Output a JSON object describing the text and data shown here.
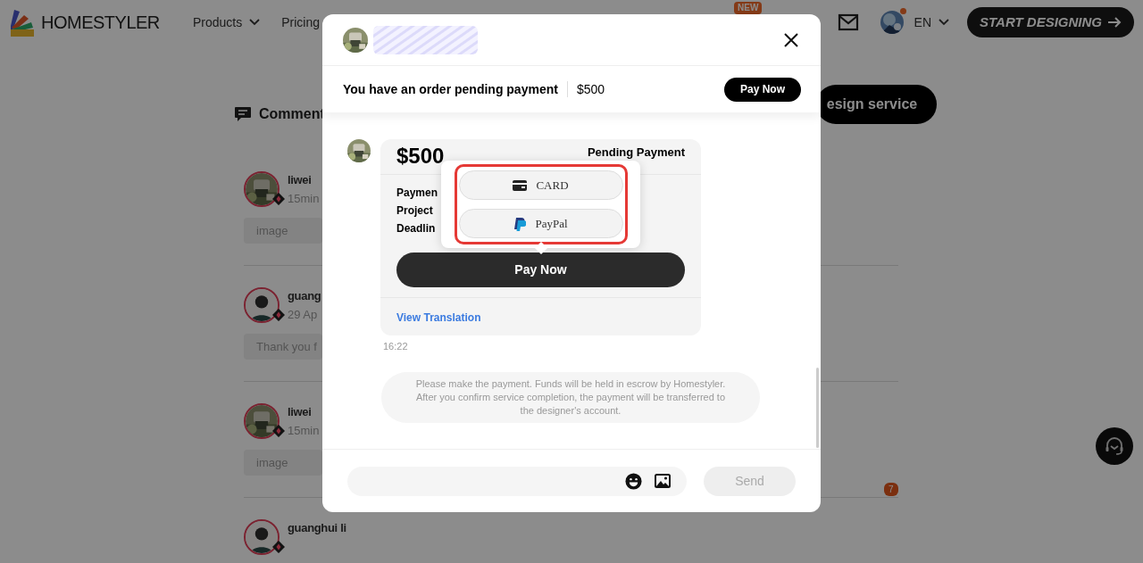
{
  "header": {
    "logo_text": "HOMESTYLER",
    "nav": [
      {
        "label": "Products",
        "dropdown": true
      },
      {
        "label": "Pricing",
        "dropdown": false
      }
    ],
    "new_badge": "NEW",
    "notification_dot": true,
    "language": "EN",
    "cta": "START DESIGNING"
  },
  "page": {
    "comment_tab": "Comment",
    "design_service_button": "esign service",
    "comments": [
      {
        "name": "liwei",
        "time": "15min",
        "text": "image"
      },
      {
        "name": "guang",
        "time": "29 Ap",
        "text": "Thank you f",
        "kind": "cartoon"
      },
      {
        "name": "liwei",
        "time": "15min",
        "text": "image"
      },
      {
        "name": "guanghui li",
        "kind": "cartoon"
      }
    ],
    "unread_badge": "7"
  },
  "dialog": {
    "pending_bar": {
      "message": "You have an order pending payment",
      "amount": "$500",
      "button": "Pay Now"
    },
    "messages": [
      {
        "kind": "order_card",
        "amount": "$500",
        "status": "Pending Payment",
        "fields": [
          "Paymen",
          "Project",
          "Deadlin"
        ],
        "button": "Pay Now",
        "translation_link": "View Translation",
        "time": "16:22"
      },
      {
        "kind": "system_note",
        "text": "Please make the payment. Funds will be held in escrow by Homestyler. After you confirm service completion, the payment will be transferred to the designer's account."
      }
    ],
    "payment_menu": {
      "options": [
        {
          "label": "CARD",
          "kind": "card"
        },
        {
          "label": "PayPal",
          "kind": "paypal"
        }
      ]
    },
    "composer": {
      "send_button": "Send",
      "send_disabled": true
    }
  }
}
